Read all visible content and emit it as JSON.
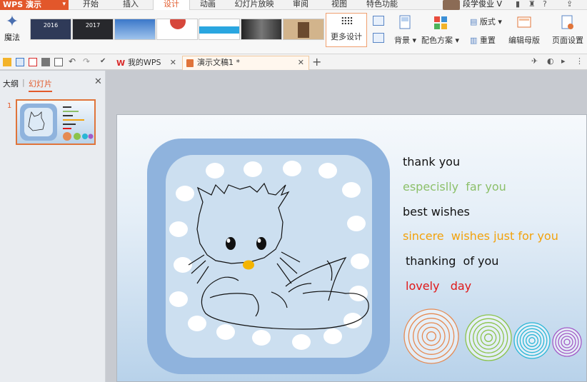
{
  "app": {
    "title": "WPS 演示"
  },
  "menu": {
    "tabs": [
      {
        "label": "开始"
      },
      {
        "label": "插入"
      },
      {
        "label": "设计"
      },
      {
        "label": "动画"
      },
      {
        "label": "幻灯片放映"
      },
      {
        "label": "审阅"
      },
      {
        "label": "视图"
      },
      {
        "label": "特色功能"
      }
    ],
    "active_tab": "设计",
    "user_name": "段学俊业 V",
    "help": "?"
  },
  "ribbon": {
    "magic_label": "魔法",
    "templates": [
      {
        "text": "2016",
        "color": "#2f3a58"
      },
      {
        "text": "2017",
        "color": "#27282c"
      },
      {
        "text": "",
        "color": "#3b78c9"
      },
      {
        "text": "",
        "color": "#ffffff"
      },
      {
        "text": "",
        "color": "#2aa6e0"
      },
      {
        "text": "",
        "color": "#444444"
      },
      {
        "text": "",
        "color": "#b58a5a"
      }
    ],
    "more_design_label": "更多设计",
    "background_label": "背景",
    "color_scheme_label": "配色方案",
    "layout_label": "版式",
    "reset_label": "重置",
    "edit_master_label": "编辑母版",
    "page_setup_label": "页面设置"
  },
  "doc_tabs": [
    {
      "label": "我的WPS",
      "active": false
    },
    {
      "label": "演示文稿1 *",
      "active": true
    }
  ],
  "left_panel": {
    "outline_tab": "大纲",
    "slides_tab": "幻灯片",
    "slide_number": "1"
  },
  "slide": {
    "lines": [
      {
        "text": "thank you",
        "color": "#111111"
      },
      {
        "text": "especislly  far you",
        "color": "#8cc06a"
      },
      {
        "text": "best wishes",
        "color": "#111111"
      },
      {
        "text": "sincere  wishes just for you",
        "color": "#f2a20c"
      },
      {
        "text": "thanking  of you",
        "color": "#111111"
      },
      {
        "text": "lovely   day",
        "color": "#e01818"
      }
    ],
    "frame_color": "#8fb3dd",
    "inner_color": "#ccdff0",
    "circles": [
      {
        "color": "#e58a53",
        "rings": 6
      },
      {
        "color": "#8bc34a",
        "rings": 6
      },
      {
        "color": "#29b6d6",
        "rings": 6
      },
      {
        "color": "#a35ac7",
        "rings": 5
      }
    ]
  }
}
